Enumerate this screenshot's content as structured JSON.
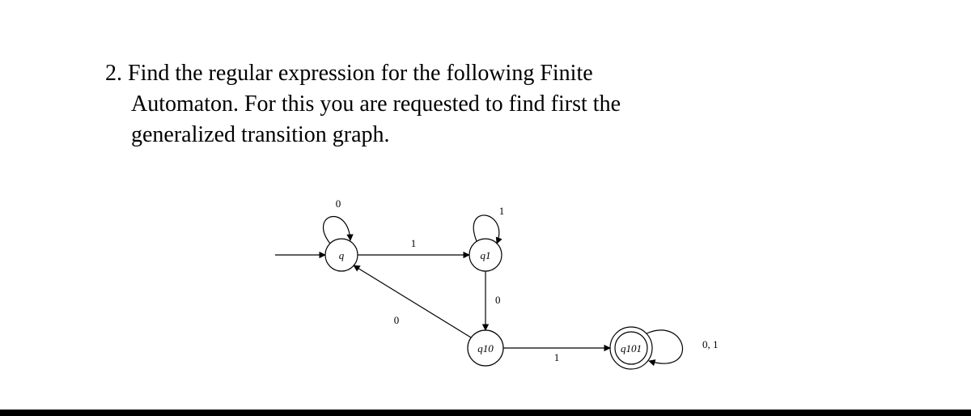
{
  "problem": {
    "number": "2.",
    "text_line1": "Find the regular expression for the following Finite",
    "text_line2": "Automaton. For this you are requested to find first the",
    "text_line3": "generalized transition graph."
  },
  "automaton": {
    "states": {
      "q": "q",
      "q1": "q1",
      "q10": "q10",
      "q101": "q101"
    },
    "edges": {
      "q_self_0": "0",
      "q_to_q1_1": "1",
      "q1_self_1": "1",
      "q1_to_q10_0": "0",
      "q10_to_q_0": "0",
      "q10_to_q101_1": "1",
      "q101_self_01": "0, 1"
    }
  }
}
